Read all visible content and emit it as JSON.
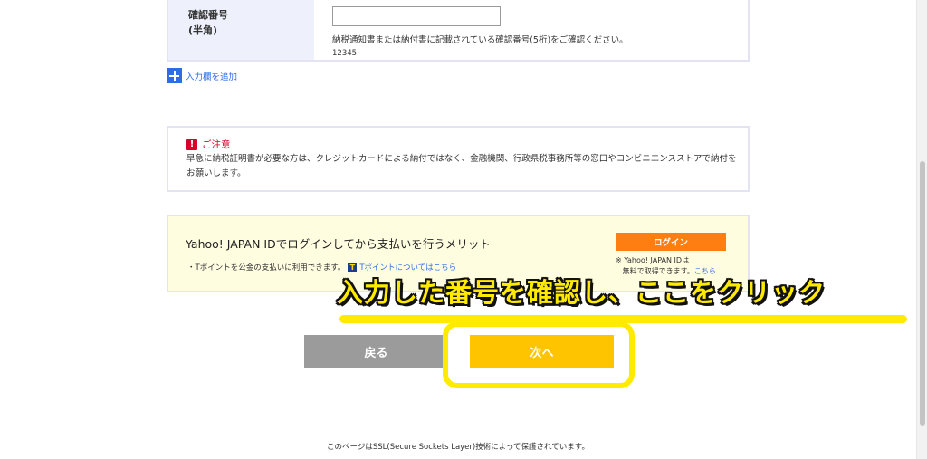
{
  "form": {
    "label_line1": "確認番号",
    "label_line2": "(半角)",
    "input_value": "",
    "hint": "納税通知書または納付書に記載されている確認番号(5桁)をご確認ください。",
    "example": "12345"
  },
  "add_field": {
    "label": "入力欄を追加",
    "icon": "plus-icon"
  },
  "caution": {
    "icon_glyph": "!",
    "title": "ご注意",
    "text": "早急に納税証明書が必要な方は、クレジットカードによる納付ではなく、金融機関、行政県税事務所等の窓口やコンビニエンスストアで納付をお願いします。"
  },
  "yahoo": {
    "title": "Yahoo! JAPAN IDでログインしてから支払いを行うメリット",
    "tpoint_text": "・Tポイントを公金の支払いに利用できます。",
    "tpoint_icon": "T",
    "tpoint_link": "Tポイントについてはこちら",
    "login_label": "ログイン",
    "note_line1": "※ Yahoo! JAPAN IDは",
    "note_line2": "無料で取得できます。",
    "note_link": "こちら"
  },
  "annotation": {
    "text": "入力した番号を確認し、ここをクリック",
    "color": "#ffea00"
  },
  "buttons": {
    "back": "戻る",
    "next": "次へ"
  },
  "footer": {
    "text": "このページはSSL(Secure Sockets Layer)技術によって保護されています。"
  },
  "colors": {
    "accent_blue": "#2f6be6",
    "caution_red": "#d8002a",
    "login_orange": "#ff7e12",
    "next_yellow": "#ffc400",
    "back_gray": "#9b9b9b"
  }
}
